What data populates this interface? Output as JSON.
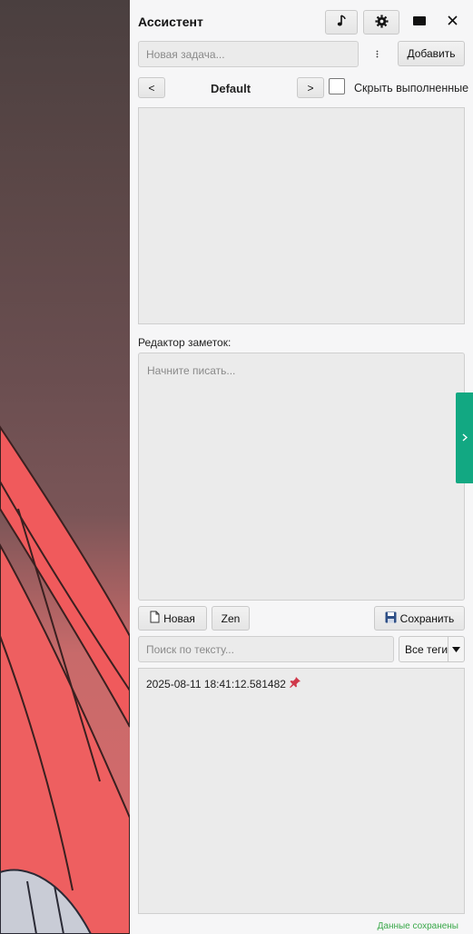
{
  "header": {
    "title": "Ассистент"
  },
  "tasks": {
    "new_task_placeholder": "Новая задача...",
    "add_label": "Добавить",
    "prev_label": "<",
    "next_label": ">",
    "list_name": "Default",
    "hide_done_label": "Скрыть выполненные"
  },
  "notes": {
    "editor_label": "Редактор заметок:",
    "editor_placeholder": "Начните писать...",
    "new_label": "Новая",
    "zen_label": "Zen",
    "save_label": "Сохранить",
    "search_placeholder": "Поиск по тексту...",
    "tags_selected": "Все теги",
    "items": [
      {
        "title": "2025-08-11 18:41:12.581482"
      }
    ]
  },
  "status_text": "Данные сохранены",
  "colors": {
    "accent": "#12a882",
    "status": "#3aa84a",
    "pin": "#d0384a"
  },
  "icons": [
    "music-note-icon",
    "gear-icon",
    "window-icon",
    "close-icon",
    "more-vertical-icon",
    "new-file-icon",
    "save-icon",
    "chevron-down-icon",
    "pin-icon",
    "chevron-right-icon"
  ]
}
